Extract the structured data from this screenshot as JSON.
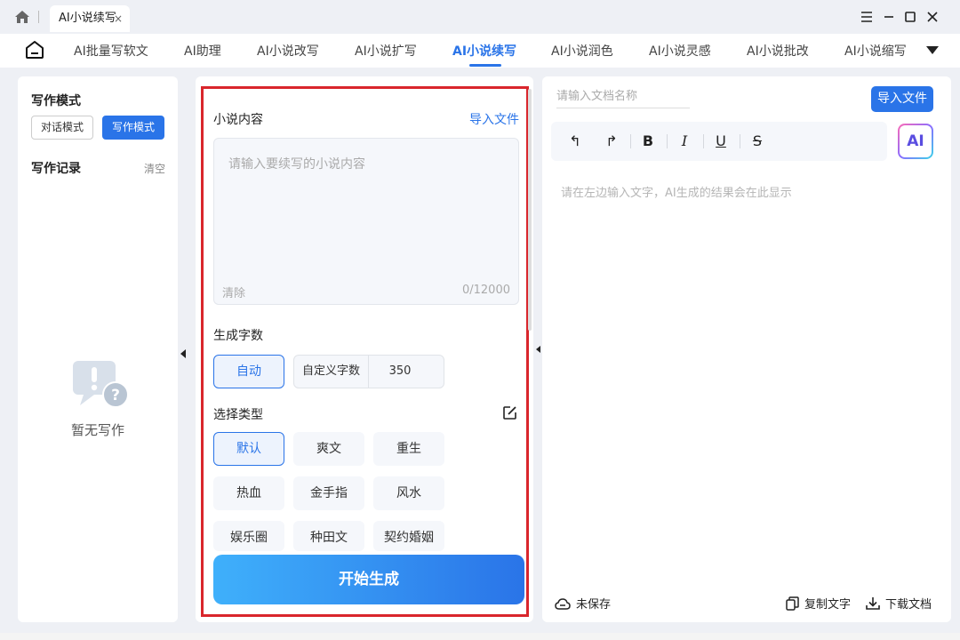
{
  "window": {
    "tab_title": "AI小说续写",
    "tab_close": "×"
  },
  "nav": {
    "items": [
      "AI批量写软文",
      "AI助理",
      "AI小说改写",
      "AI小说扩写",
      "AI小说续写",
      "AI小说润色",
      "AI小说灵感",
      "AI小说批改",
      "AI小说缩写"
    ],
    "active_index": 4,
    "accent_color": "#2a74e8"
  },
  "left_panel": {
    "mode_title": "写作模式",
    "mode_options": [
      "对话模式",
      "写作模式"
    ],
    "selected_mode": "写作模式",
    "records_title": "写作记录",
    "clear_label": "清空",
    "empty_text": "暂无写作"
  },
  "middle_panel": {
    "content_title": "小说内容",
    "import_label": "导入文件",
    "content_placeholder": "请输入要续写的小说内容",
    "clear_label": "清除",
    "char_count": "0/12000",
    "word_count_title": "生成字数",
    "auto_label": "自动",
    "custom_label": "自定义字数",
    "custom_value": "350",
    "type_title": "选择类型",
    "types": [
      "默认",
      "爽文",
      "重生",
      "热血",
      "金手指",
      "风水",
      "娱乐圈",
      "种田文",
      "契约婚姻"
    ],
    "selected_type": "默认",
    "generate_label": "开始生成"
  },
  "right_panel": {
    "doc_name_placeholder": "请输入文档名称",
    "import_label": "导入文件",
    "toolbar": {
      "undo": "↰",
      "redo": "↱",
      "bold": "B",
      "italic": "I",
      "underline": "U",
      "strike": "S"
    },
    "ai_badge": "AI",
    "output_placeholder": "请在左边输入文字，AI生成的结果会在此显示",
    "save_status": "未保存",
    "copy_label": "复制文字",
    "download_label": "下载文档"
  }
}
